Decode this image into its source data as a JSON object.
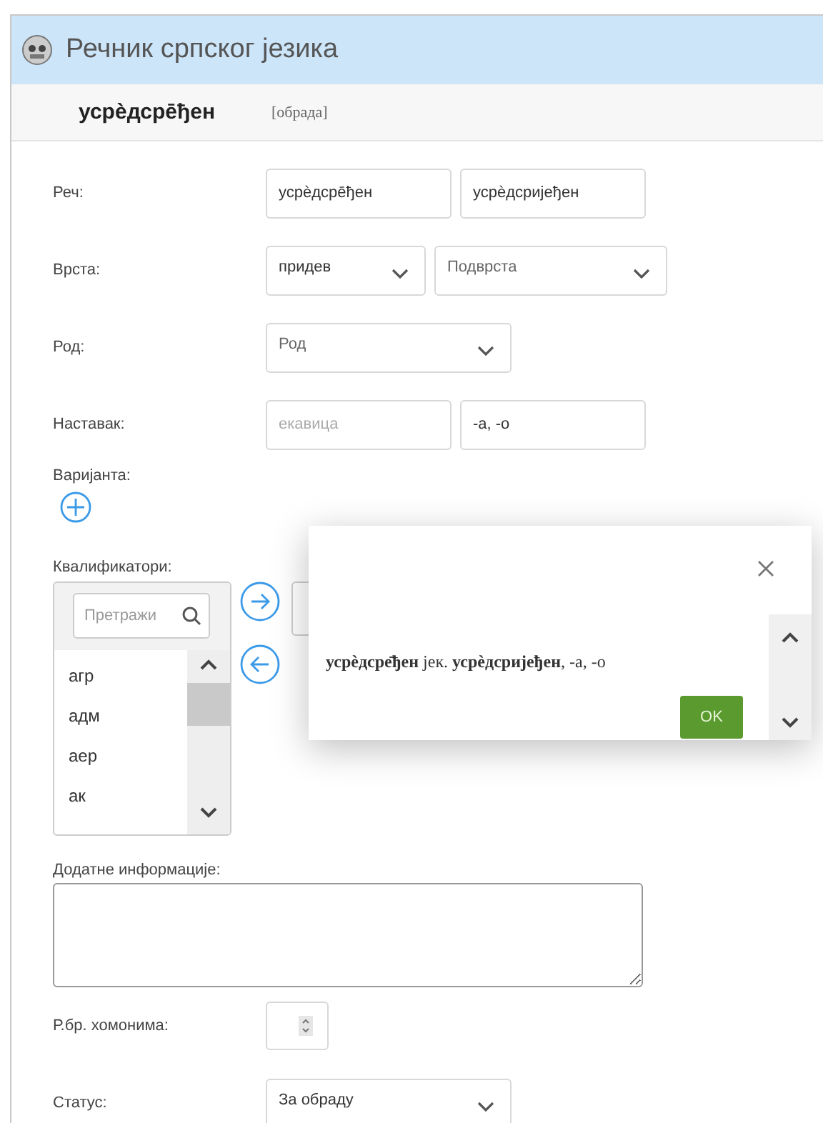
{
  "app": {
    "title": "Речник српског језика"
  },
  "entry": {
    "headword": "усрѐдсре̄ђен",
    "tag": "[обрада]"
  },
  "rows": [
    {
      "kind": "fields",
      "label": "Реч:",
      "fields": [
        {
          "kind": "input",
          "value": "усрѐдсре̄ђен"
        },
        {
          "kind": "input",
          "value": "усрѐдсријеђен"
        }
      ]
    },
    {
      "kind": "fields",
      "label": "Врста:",
      "fields": [
        {
          "kind": "select",
          "value": "придев"
        },
        {
          "kind": "select",
          "placeholder": "Подврста"
        }
      ]
    },
    {
      "kind": "fields",
      "label": "Род:",
      "fields": [
        {
          "kind": "select",
          "placeholder": "Род"
        }
      ]
    },
    {
      "kind": "fields",
      "label": "Наставак:",
      "fields": [
        {
          "kind": "input",
          "placeholder": "екавица"
        },
        {
          "kind": "input",
          "value": "-а, -о"
        }
      ]
    },
    {
      "kind": "add",
      "label": "Варијанта:"
    },
    {
      "kind": "qualifiers",
      "label": "Квалификатори:",
      "search_placeholder": "Претражи",
      "items": [
        "агр",
        "адм",
        "аер",
        "ак"
      ]
    },
    {
      "kind": "textarea",
      "label": "Додатне информације:"
    },
    {
      "kind": "number",
      "label": "Р.бр. хомонима:"
    },
    {
      "kind": "fields",
      "label": "Статус:",
      "fields": [
        {
          "kind": "select",
          "value": "За обраду"
        }
      ]
    }
  ],
  "dialog": {
    "message": "**усрѐдсре̄ђен** јек. **усрѐдсријеђен**, -а, -о",
    "ok": "OK"
  }
}
